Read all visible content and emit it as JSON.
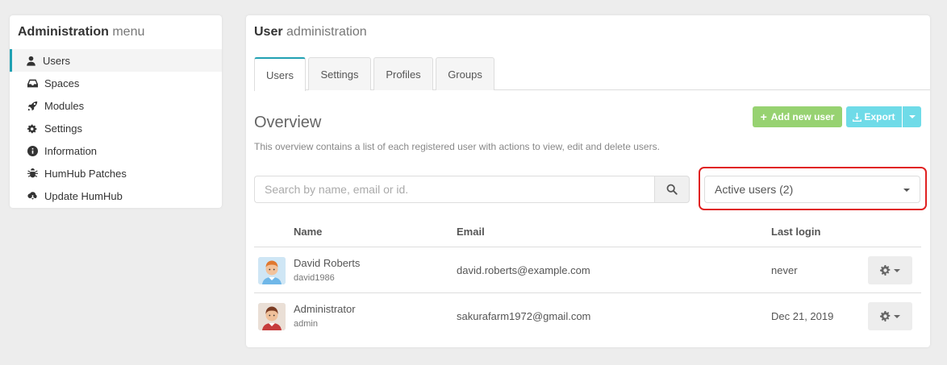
{
  "sidebar": {
    "title_bold": "Administration",
    "title_rest": "menu",
    "items": [
      {
        "label": "Users",
        "icon": "user-icon"
      },
      {
        "label": "Spaces",
        "icon": "inbox-icon"
      },
      {
        "label": "Modules",
        "icon": "rocket-icon"
      },
      {
        "label": "Settings",
        "icon": "cogs-icon"
      },
      {
        "label": "Information",
        "icon": "info-circle-icon"
      },
      {
        "label": "HumHub Patches",
        "icon": "bug-icon"
      },
      {
        "label": "Update HumHub",
        "icon": "cloud-download-icon"
      }
    ]
  },
  "panel": {
    "title_bold": "User",
    "title_rest": "administration",
    "tabs": [
      "Users",
      "Settings",
      "Profiles",
      "Groups"
    ],
    "overview_title": "Overview",
    "overview_desc": "This overview contains a list of each registered user with actions to view, edit and delete users.",
    "add_user_label": "Add new user",
    "export_label": "Export",
    "search_placeholder": "Search by name, email or id.",
    "filter_value": "Active users (2)",
    "colors": {
      "accent": "#21a1b3",
      "add_button": "#97d271",
      "export_button": "#6fdbe8",
      "highlight": "#e02020"
    }
  },
  "table": {
    "headers": {
      "name": "Name",
      "email": "Email",
      "last_login": "Last login"
    },
    "rows": [
      {
        "name": "David Roberts",
        "username": "david1986",
        "email": "david.roberts@example.com",
        "last_login": "never"
      },
      {
        "name": "Administrator",
        "username": "admin",
        "email": "sakurafarm1972@gmail.com",
        "last_login": "Dec 21, 2019"
      }
    ]
  }
}
